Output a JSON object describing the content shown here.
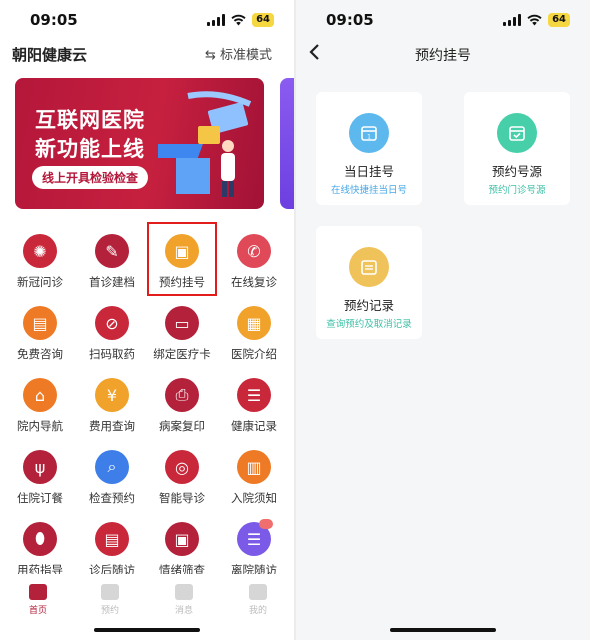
{
  "status_bar": {
    "time": "09:05",
    "battery": "64"
  },
  "left": {
    "app_title": "朝阳健康云",
    "mode_switch": "⇆ 标准模式",
    "banner": {
      "title_line1": "互联网医院",
      "title_line2": "新功能上线",
      "subtitle": "线上开具检验检查"
    },
    "grid": [
      {
        "label": "新冠问诊",
        "icon": "virus-icon"
      },
      {
        "label": "首诊建档",
        "icon": "edit-icon"
      },
      {
        "label": "预约挂号",
        "icon": "calendar-check-icon"
      },
      {
        "label": "在线复诊",
        "icon": "phone-icon"
      },
      {
        "label": "免费咨询",
        "icon": "chat-icon"
      },
      {
        "label": "扫码取药",
        "icon": "pill-scan-icon"
      },
      {
        "label": "绑定医疗卡",
        "icon": "card-icon"
      },
      {
        "label": "医院介绍",
        "icon": "building-icon"
      },
      {
        "label": "院内导航",
        "icon": "map-pin-icon"
      },
      {
        "label": "费用查询",
        "icon": "bill-icon"
      },
      {
        "label": "病案复印",
        "icon": "printer-icon"
      },
      {
        "label": "健康记录",
        "icon": "record-icon"
      },
      {
        "label": "住院订餐",
        "icon": "meal-icon"
      },
      {
        "label": "检查预约",
        "icon": "search-calendar-icon"
      },
      {
        "label": "智能导诊",
        "icon": "target-icon"
      },
      {
        "label": "入院须知",
        "icon": "book-icon"
      },
      {
        "label": "用药指导",
        "icon": "pills-icon"
      },
      {
        "label": "诊后随访",
        "icon": "clipboard-icon"
      },
      {
        "label": "情绪筛查",
        "icon": "photo-card-icon"
      },
      {
        "label": "离院随访",
        "icon": "document-icon"
      }
    ],
    "tabs": [
      {
        "label": "首页",
        "active": true
      },
      {
        "label": "预约",
        "active": false
      },
      {
        "label": "消息",
        "active": false
      },
      {
        "label": "我的",
        "active": false
      }
    ]
  },
  "right": {
    "title": "预约挂号",
    "cards": [
      {
        "title": "当日挂号",
        "subtitle": "在线快捷挂当日号",
        "subtitle_color": "#4aa8e6",
        "icon_color": "#5db8ee",
        "icon": "calendar-today-icon"
      },
      {
        "title": "预约号源",
        "subtitle": "预约门诊号源",
        "subtitle_color": "#3cbfa6",
        "icon_color": "#47cfaa",
        "icon": "calendar-check-icon"
      },
      {
        "title": "预约记录",
        "subtitle": "查询预约及取消记录",
        "subtitle_color": "#3cbfa6",
        "icon_color": "#f0c35a",
        "icon": "records-icon"
      }
    ]
  }
}
